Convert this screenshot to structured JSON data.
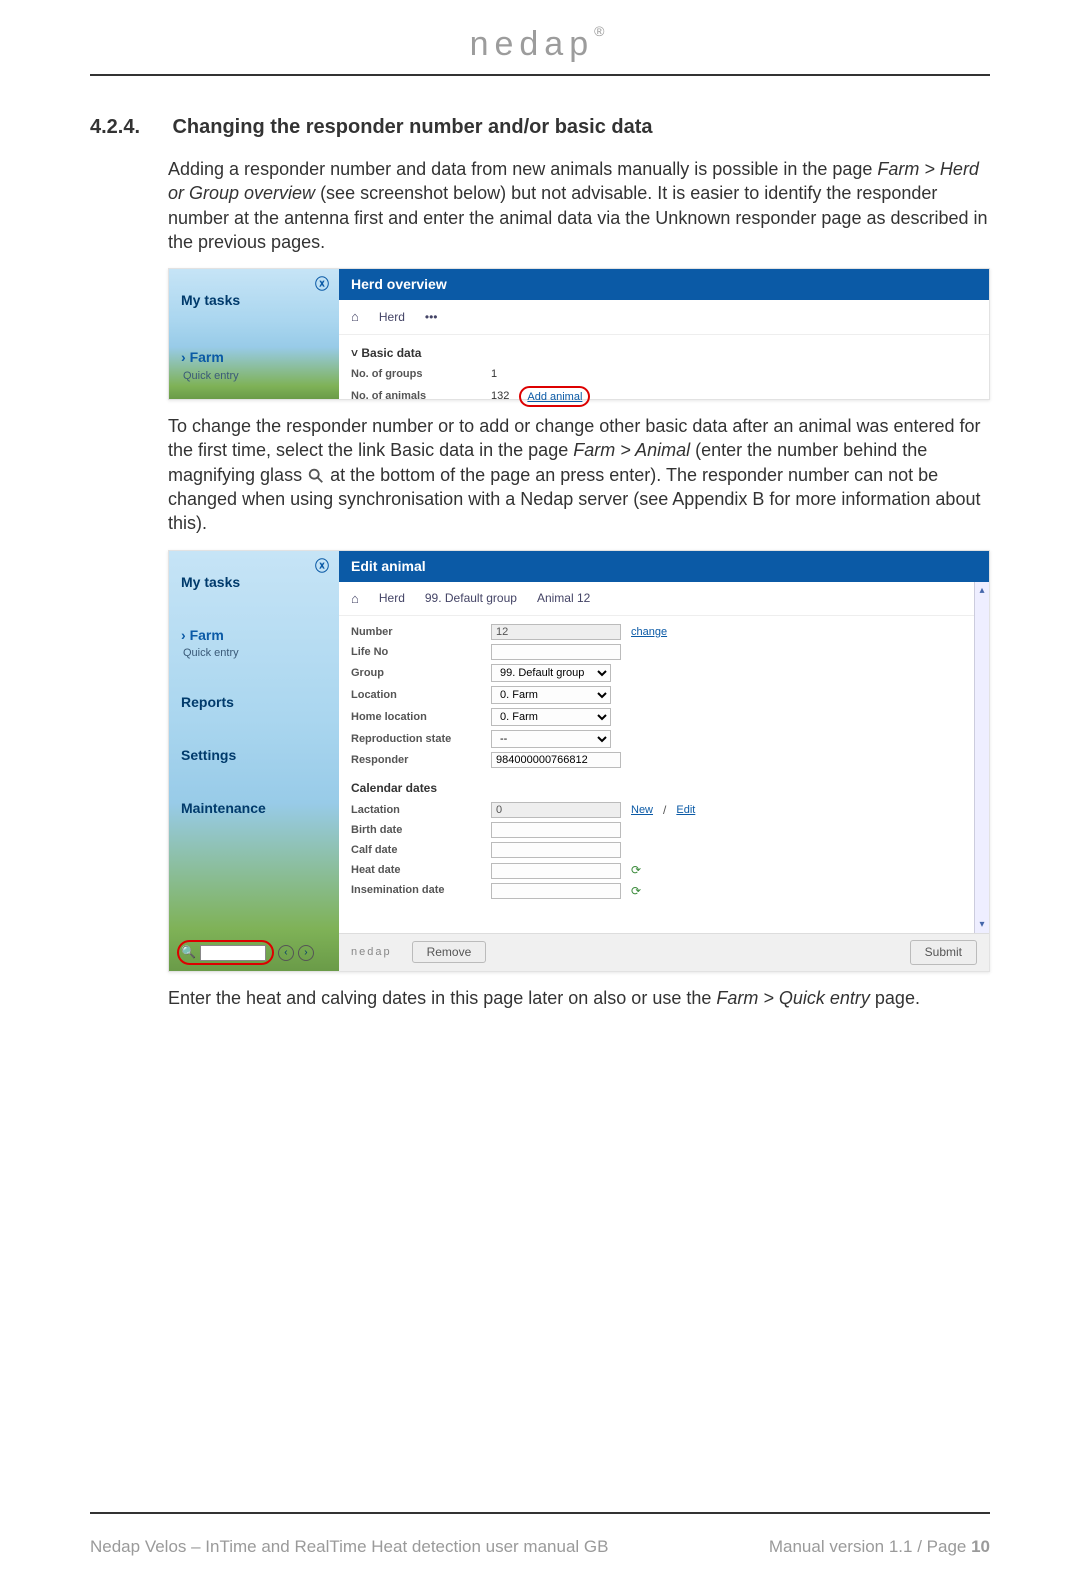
{
  "brand": "nedap",
  "brand_r": "®",
  "section": {
    "num": "4.2.4.",
    "title": "Changing the responder number and/or basic data"
  },
  "p1a": "Adding a responder number and data from new animals manually is possible in the page ",
  "p1b": "Farm > Herd or Group overview",
  "p1c": " (see screenshot below) but not advisable. It is easier to identify the responder number at the antenna first and enter the animal data via the Unknown responder page as described in the previous pages.",
  "p2a": "To change the responder number or to add or change other basic data after an animal was entered for the first time, select the link Basic data in the page ",
  "p2b": "Farm > Animal",
  "p2c": " (enter the number behind the magnifying glass ",
  "p2d": " at the bottom of the page an press enter). The responder number can not be changed when using synchronisation with a Nedap server (see Appendix B for more information about this).",
  "p3a": "Enter the heat and calving dates in this page later on also or use the ",
  "p3b": "Farm > Quick entry",
  "p3c": " page.",
  "shot1": {
    "title": "Herd overview",
    "side": {
      "mytasks": "My tasks",
      "farm": "Farm",
      "quick": "Quick entry",
      "caret": "›"
    },
    "crumb": {
      "home": "⌂",
      "herd": "Herd",
      "dots": "•••"
    },
    "basic": {
      "hdr": "Basic data",
      "arrow": "˅",
      "g": "No. of groups",
      "gv": "1",
      "a": "No. of animals",
      "av": "132",
      "add": "Add animal"
    }
  },
  "shot2": {
    "title": "Edit animal",
    "side": {
      "mytasks": "My tasks",
      "farm": "Farm",
      "quick": "Quick entry",
      "reports": "Reports",
      "settings": "Settings",
      "maint": "Maintenance",
      "caret": "›"
    },
    "crumb": {
      "home": "⌂",
      "herd": "Herd",
      "grp": "99. Default group",
      "ani": "Animal 12"
    },
    "fields": {
      "number": "Number",
      "number_v": "12",
      "change": "change",
      "life": "Life No",
      "group": "Group",
      "group_v": "99. Default group",
      "loc": "Location",
      "loc_v": "0. Farm",
      "home": "Home location",
      "home_v": "0. Farm",
      "repro": "Reproduction state",
      "repro_v": "--",
      "resp": "Responder",
      "resp_v": "984000000766812"
    },
    "cal": {
      "hdr": "Calendar dates",
      "lact": "Lactation",
      "lact_v": "0",
      "new": "New",
      "slash": "/",
      "edit": "Edit",
      "birth": "Birth date",
      "calf": "Calf date",
      "heat": "Heat date",
      "insem": "Insemination date"
    },
    "bot": {
      "brand": "nedap",
      "remove": "Remove",
      "submit": "Submit"
    },
    "search": {
      "mag": "🔍",
      "left": "‹",
      "right": "›"
    }
  },
  "footer": {
    "left": "Nedap Velos – InTime and RealTime Heat detection user manual GB",
    "right_a": "Manual version 1.1 / Page ",
    "right_b": "10"
  }
}
